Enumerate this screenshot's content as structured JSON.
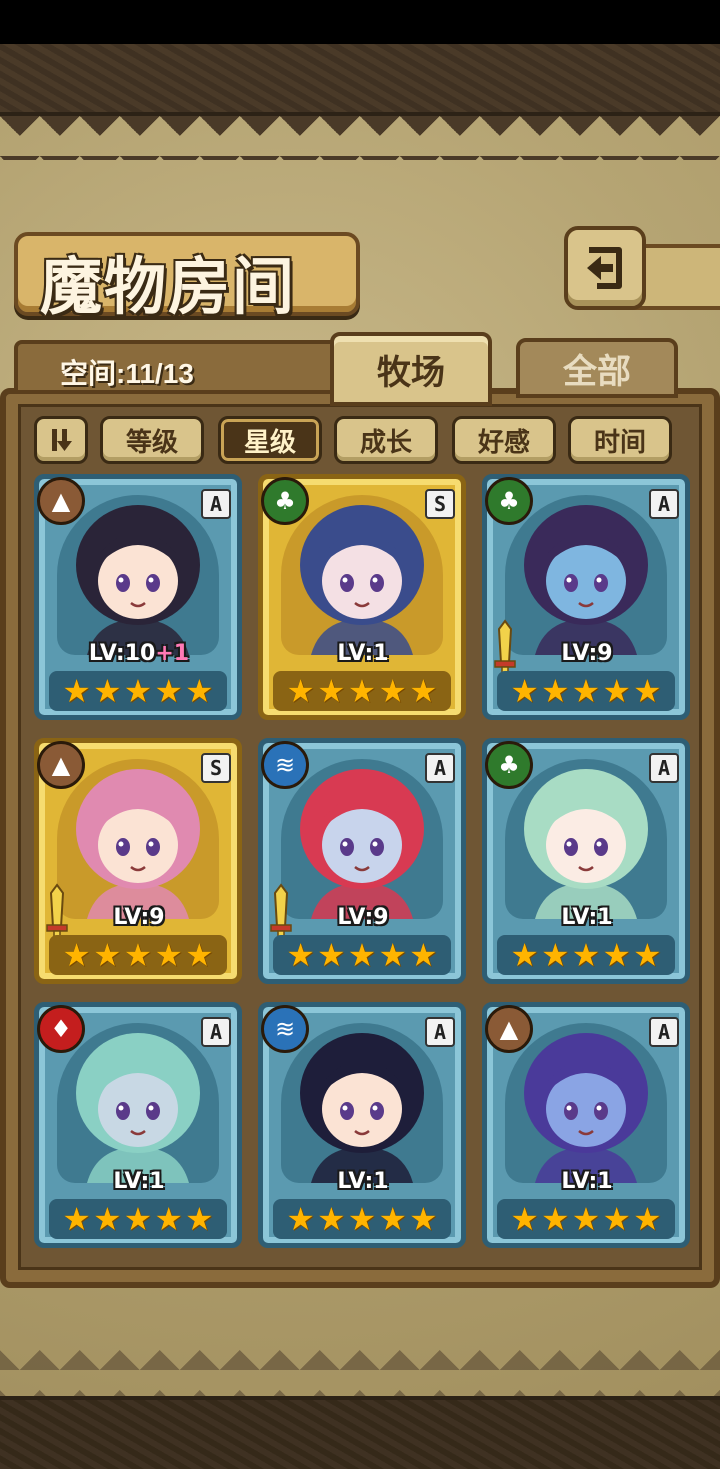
{
  "title": "魔物房间",
  "space": {
    "label": "空间:11/13"
  },
  "tabs": [
    {
      "label": "牧场",
      "active": true
    },
    {
      "label": "全部",
      "active": false
    }
  ],
  "filters": {
    "sort_icon": "sort-toggle-icon",
    "items": [
      {
        "label": "等级",
        "active": false
      },
      {
        "label": "星级",
        "active": true
      },
      {
        "label": "成长",
        "active": false
      },
      {
        "label": "好感",
        "active": false
      },
      {
        "label": "时间",
        "active": false
      }
    ]
  },
  "monsters": [
    {
      "element": "earth",
      "rank": "A",
      "level": "LV:10",
      "bonus": "+1",
      "stars": 5,
      "frame": "blue",
      "weapon": false,
      "hair": "#2a2438",
      "skin": "#fbe3d4"
    },
    {
      "element": "leaf",
      "rank": "S",
      "level": "LV:1",
      "bonus": "",
      "stars": 5,
      "frame": "gold",
      "weapon": false,
      "hair": "#3a4c8c",
      "skin": "#f4e0e4"
    },
    {
      "element": "leaf",
      "rank": "A",
      "level": "LV:9",
      "bonus": "",
      "stars": 5,
      "frame": "blue",
      "weapon": true,
      "hair": "#3a2a5a",
      "skin": "#7fb6e0"
    },
    {
      "element": "earth",
      "rank": "S",
      "level": "LV:9",
      "bonus": "",
      "stars": 5,
      "frame": "gold",
      "weapon": true,
      "hair": "#e08ab0",
      "skin": "#fbe3d4"
    },
    {
      "element": "water",
      "rank": "A",
      "level": "LV:9",
      "bonus": "",
      "stars": 5,
      "frame": "blue",
      "weapon": true,
      "hair": "#d83a52",
      "skin": "#c8d4ec"
    },
    {
      "element": "leaf",
      "rank": "A",
      "level": "LV:1",
      "bonus": "",
      "stars": 5,
      "frame": "blue",
      "weapon": false,
      "hair": "#a8dcc4",
      "skin": "#fbece4"
    },
    {
      "element": "fire",
      "rank": "A",
      "level": "LV:1",
      "bonus": "",
      "stars": 5,
      "frame": "blue",
      "weapon": false,
      "hair": "#8ad0c4",
      "skin": "#c8d8e4"
    },
    {
      "element": "water",
      "rank": "A",
      "level": "LV:1",
      "bonus": "",
      "stars": 5,
      "frame": "blue",
      "weapon": false,
      "hair": "#1e1e3a",
      "skin": "#fbe3d4"
    },
    {
      "element": "earth",
      "rank": "A",
      "level": "LV:1",
      "bonus": "",
      "stars": 5,
      "frame": "blue",
      "weapon": false,
      "hair": "#4a3a9a",
      "skin": "#8aa4e4"
    }
  ],
  "icons": {
    "back": "back-arrow-icon",
    "earth": "mountain-icon",
    "leaf": "leaf-icon",
    "water": "wave-icon",
    "fire": "flame-icon",
    "weapon": "sword-icon",
    "star": "star-icon"
  }
}
